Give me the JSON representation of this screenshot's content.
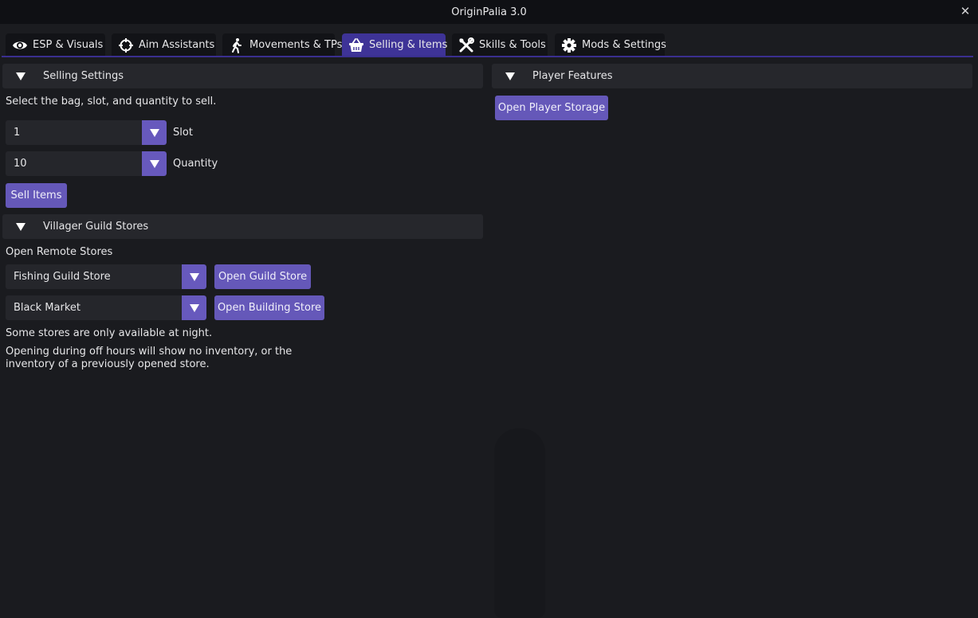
{
  "window": {
    "title": "OriginPalia 3.0",
    "close_icon": "close-icon"
  },
  "tabs": [
    {
      "label": "ESP & Visuals",
      "icon": "eye-icon",
      "active": false
    },
    {
      "label": "Aim Assistants",
      "icon": "crosshair-icon",
      "active": false
    },
    {
      "label": "Movements & TPs",
      "icon": "walking-person-icon",
      "active": false
    },
    {
      "label": "Selling & Items",
      "icon": "basket-icon",
      "active": true
    },
    {
      "label": "Skills & Tools",
      "icon": "tools-icon",
      "active": false
    },
    {
      "label": "Mods & Settings",
      "icon": "gear-icon",
      "active": false
    }
  ],
  "accent_color": "#6558b9",
  "active_tab_color": "#3e3397",
  "selling_settings": {
    "header": "Selling Settings",
    "description": "Select the bag, slot, and quantity to sell.",
    "slot": {
      "value": "1",
      "label": "Slot"
    },
    "quantity": {
      "value": "10",
      "label": "Quantity"
    },
    "sell_button": "Sell Items"
  },
  "villager_guild_stores": {
    "header": "Villager Guild Stores",
    "subheading": "Open Remote Stores",
    "guild_store": {
      "value": "Fishing Guild Store",
      "button": "Open Guild Store"
    },
    "building_store": {
      "value": "Black Market",
      "button": "Open Building Store"
    },
    "note1": "Some stores are only available at night.",
    "note2_line1": "Opening during off hours will show no inventory, or the",
    "note2_line2": "inventory of a previously opened store."
  },
  "player_features": {
    "header": "Player Features",
    "storage_button": "Open Player Storage"
  }
}
